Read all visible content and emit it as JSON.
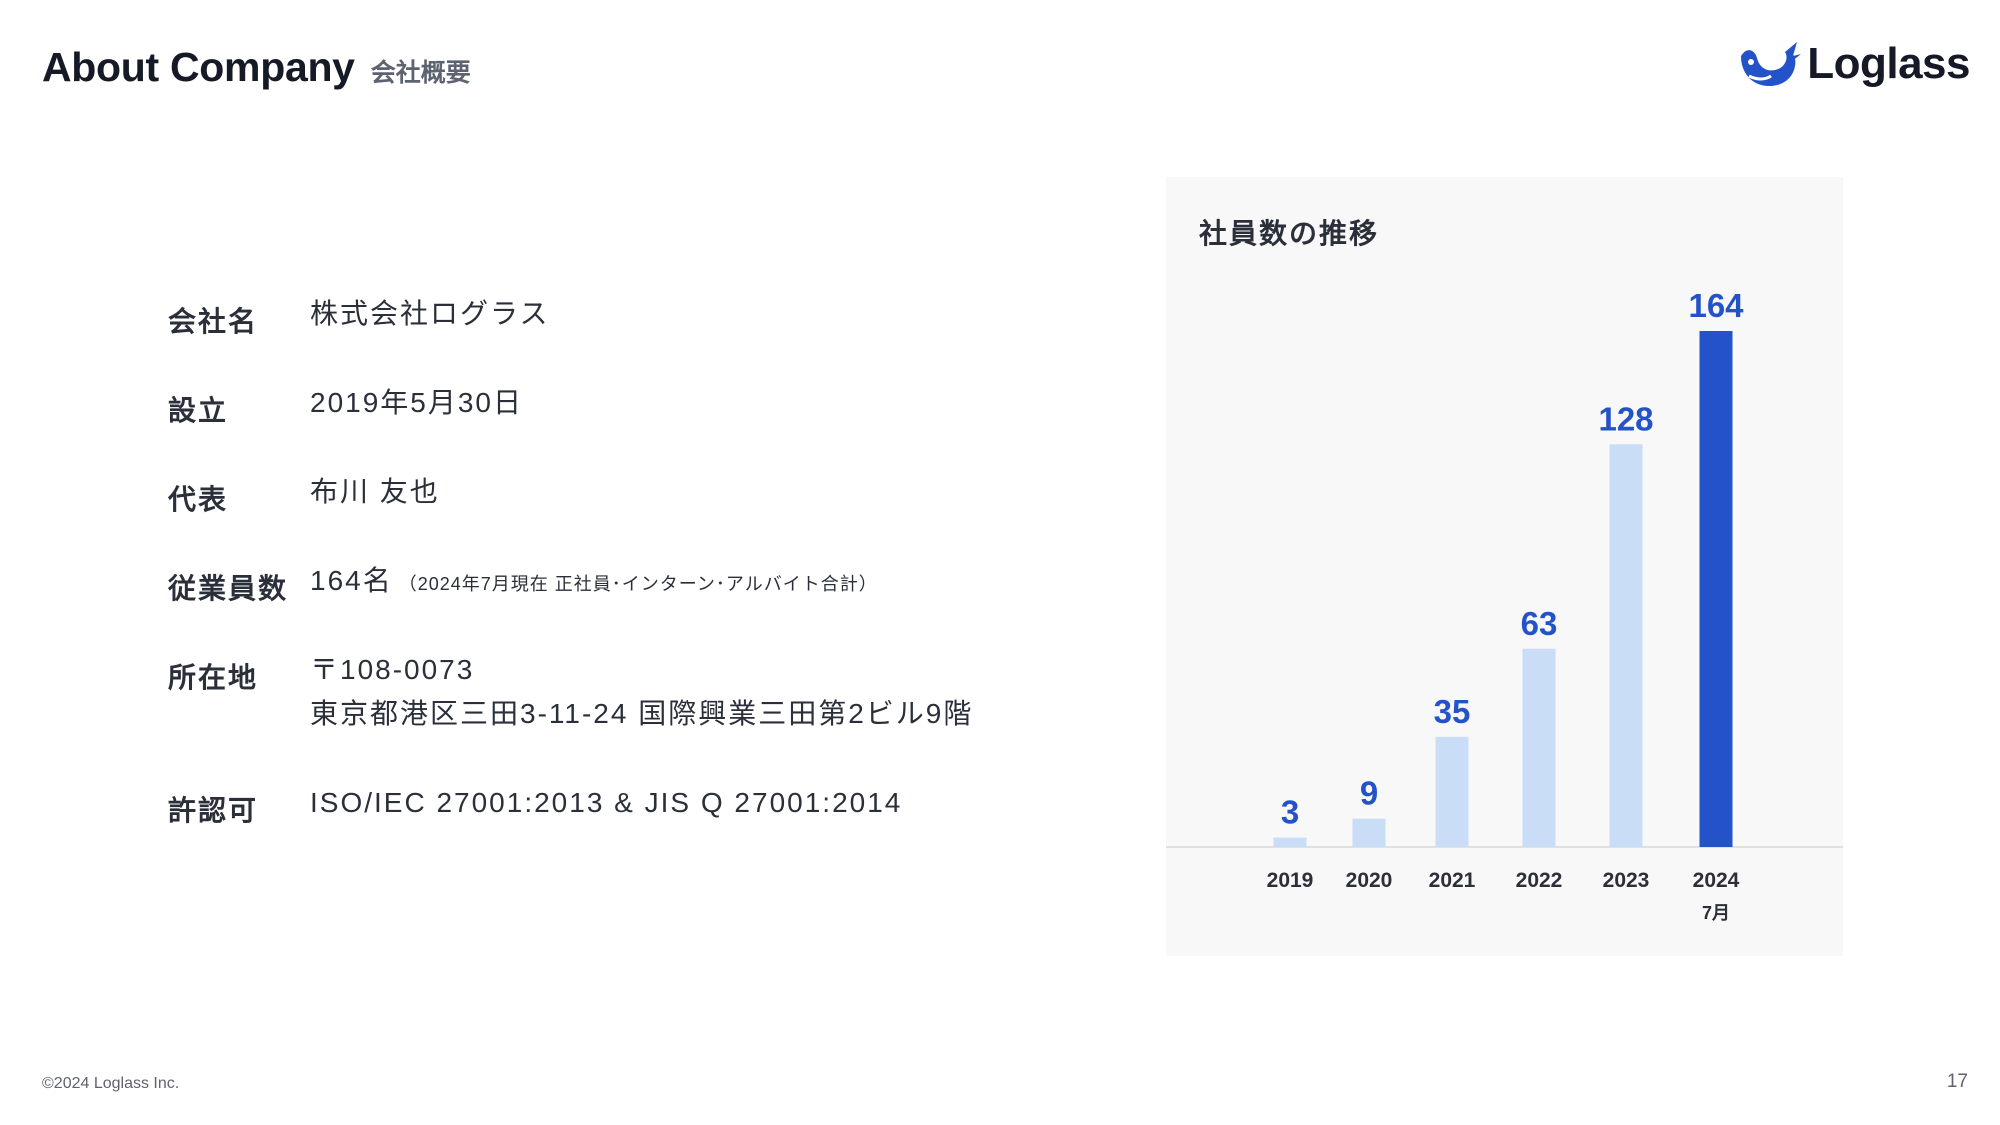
{
  "header": {
    "title": "About Company",
    "subtitle": "会社概要",
    "logo_text": "Loglass"
  },
  "info": [
    {
      "label": "会社名",
      "value": "株式会社ログラス"
    },
    {
      "label": "設立",
      "value": "2019年5月30日"
    },
    {
      "label": "代表",
      "value": "布川 友也"
    },
    {
      "label": "従業員数",
      "value": "164名",
      "note": "（2024年7月現在 正社員･インターン･アルバイト合計）"
    },
    {
      "label": "所在地",
      "value": "〒108-0073",
      "value2": "東京都港区三田3-11-24 国際興業三田第2ビル9階"
    },
    {
      "label": "許認可",
      "value": "ISO/IEC 27001:2013 & JIS Q 27001:2014"
    }
  ],
  "chart_data": {
    "type": "bar",
    "title": "社員数の推移",
    "categories": [
      "2019",
      "2020",
      "2021",
      "2022",
      "2023",
      "2024"
    ],
    "category_sublabels": [
      "",
      "",
      "",
      "",
      "",
      "7月"
    ],
    "values": [
      3,
      9,
      35,
      63,
      128,
      164
    ],
    "data_labels": [
      "3",
      "9",
      "35",
      "63",
      "128",
      "164"
    ],
    "ylim": [
      0,
      164
    ],
    "grid": false,
    "highlight_index": 5,
    "colors": {
      "bar": "#c9ddf7",
      "highlight": "#2453c9",
      "label": "#2453c9",
      "axis": "#d9d9d9"
    }
  },
  "footer": {
    "copyright": "©2024 Loglass Inc.",
    "page_number": "17"
  },
  "colors": {
    "accent": "#2453c9",
    "text": "#2a2f3a"
  }
}
